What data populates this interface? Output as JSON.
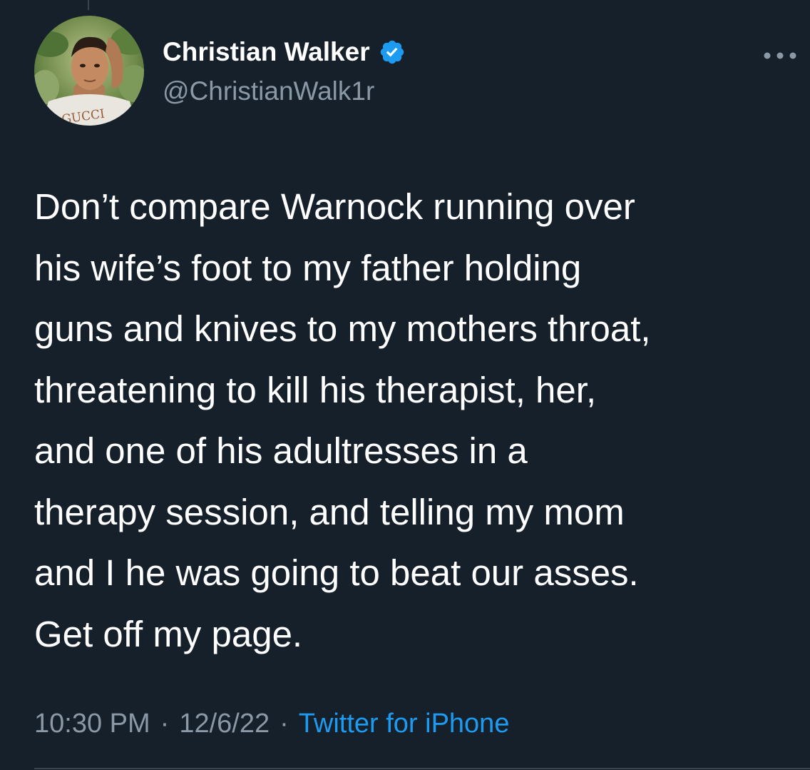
{
  "tweet": {
    "author": {
      "display_name": "Christian Walker",
      "handle": "@ChristianWalk1r",
      "verified": true,
      "avatar_icon": "profile-photo",
      "avatar_shirt_text": "GUCCI"
    },
    "more_icon": "more-horizontal-icon",
    "text_lines": [
      "Don’t compare Warnock running over",
      "his wife’s foot to my father holding",
      "guns and knives to my mothers throat,",
      "threatening to kill his therapist, her,",
      "and one of his adultresses in a",
      "therapy session, and telling my mom",
      "and I he was going to beat our asses.",
      "Get off my page."
    ],
    "time": "10:30 PM",
    "separator": "·",
    "date": "12/6/22",
    "source": "Twitter for iPhone"
  },
  "colors": {
    "background": "#15202b",
    "text_primary": "#ffffff",
    "text_secondary": "#8b98a5",
    "accent": "#1d9bf0",
    "divider": "#38444d"
  }
}
